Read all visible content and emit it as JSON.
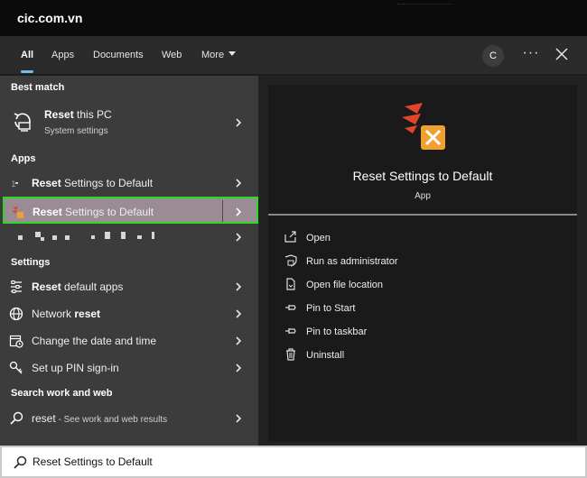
{
  "watermark": "cic.com.vn",
  "tabs": {
    "all": "All",
    "apps": "Apps",
    "documents": "Documents",
    "web": "Web",
    "more": "More"
  },
  "profile_initial": "C",
  "ellipsis": "···",
  "left": {
    "best_match_heading": "Best match",
    "best": {
      "bold": "Reset",
      "rest": " this PC",
      "sub": "System settings"
    },
    "apps_heading": "Apps",
    "app1": {
      "bold": "Reset",
      "rest": " Settings to Default"
    },
    "app2": {
      "bold": "Reset",
      "rest": " Settings to Default"
    },
    "settings_heading": "Settings",
    "set1": {
      "bold": "Reset",
      "rest": " default apps"
    },
    "set2": {
      "pre": "Network ",
      "bold": "reset"
    },
    "set3": {
      "text": "Change the date and time"
    },
    "set4": {
      "text": "Set up PIN sign-in"
    },
    "web_heading": "Search work and web",
    "web": {
      "term": "reset",
      "rest": " - See work and web results"
    }
  },
  "preview": {
    "title": "Reset Settings to Default",
    "type": "App"
  },
  "actions": [
    "Open",
    "Run as administrator",
    "Open file location",
    "Pin to Start",
    "Pin to taskbar",
    "Uninstall"
  ],
  "search": {
    "value": "Reset Settings to Default"
  },
  "colors": {
    "selected_row": "#9a8b95",
    "highlight_border": "#2ed829",
    "active_tab_underline": "#76b9ed",
    "icon_orange": "#f0a030",
    "icon_red": "#e2452a"
  }
}
